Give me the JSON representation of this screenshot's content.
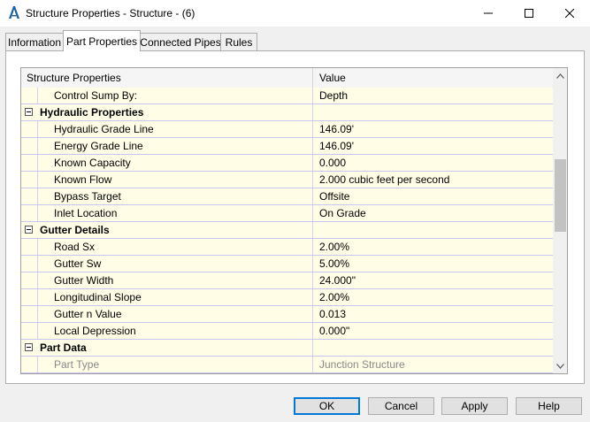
{
  "window": {
    "title": "Structure Properties - Structure - (6)"
  },
  "tabs": [
    {
      "label": "Information"
    },
    {
      "label": "Part Properties"
    },
    {
      "label": "Connected Pipes"
    },
    {
      "label": "Rules"
    }
  ],
  "grid": {
    "columns": {
      "property": "Structure Properties",
      "value": "Value"
    },
    "rows": [
      {
        "name": "Control Sump By:",
        "value": "Depth"
      },
      {
        "name": "Hydraulic Properties",
        "value": ""
      },
      {
        "name": "Hydraulic Grade Line",
        "value": "146.09'"
      },
      {
        "name": "Energy Grade Line",
        "value": "146.09'"
      },
      {
        "name": "Known Capacity",
        "value": "0.000"
      },
      {
        "name": "Known Flow",
        "value": "2.000 cubic feet per second"
      },
      {
        "name": "Bypass Target",
        "value": "Offsite"
      },
      {
        "name": "Inlet Location",
        "value": "On Grade"
      },
      {
        "name": "Gutter Details",
        "value": ""
      },
      {
        "name": "Road Sx",
        "value": "2.00%"
      },
      {
        "name": "Gutter Sw",
        "value": "5.00%"
      },
      {
        "name": "Gutter Width",
        "value": "24.000\""
      },
      {
        "name": "Longitudinal Slope",
        "value": "2.00%"
      },
      {
        "name": "Gutter n Value",
        "value": "0.013"
      },
      {
        "name": "Local Depression",
        "value": "0.000\""
      },
      {
        "name": "Part Data",
        "value": ""
      },
      {
        "name": "Part Type",
        "value": "Junction Structure"
      }
    ]
  },
  "buttons": {
    "ok": "OK",
    "cancel": "Cancel",
    "apply": "Apply",
    "help": "Help"
  },
  "icons": {
    "app": "autocad-civil-icon",
    "minimize": "minimize-icon",
    "maximize": "maximize-icon",
    "close": "close-icon"
  },
  "colors": {
    "row_background": "#fffde6",
    "default_button_border": "#0078d7",
    "app_icon": "#1f5fa8"
  }
}
